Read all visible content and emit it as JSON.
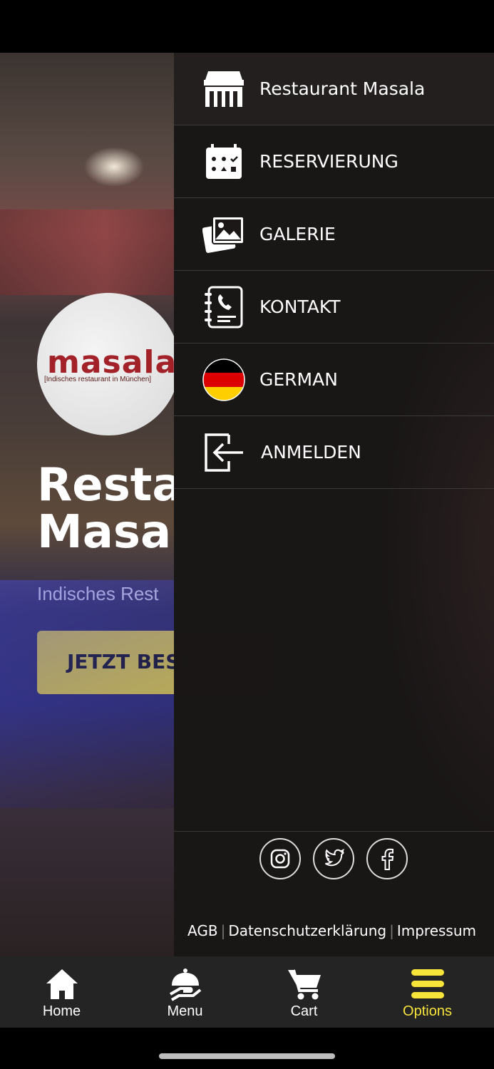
{
  "hero": {
    "logo_word": "masala",
    "logo_sub": "[Indisches restaurant in München]",
    "title_line1": "Resta",
    "title_line2": "Masa",
    "subtitle": "Indisches Rest",
    "order_button": "JETZT BEST"
  },
  "drawer": {
    "items": [
      {
        "label": "Restaurant Masala",
        "icon": "store-icon"
      },
      {
        "label": "RESERVIERUNG",
        "icon": "calendar-icon"
      },
      {
        "label": "GALERIE",
        "icon": "gallery-icon"
      },
      {
        "label": "KONTAKT",
        "icon": "contact-icon"
      },
      {
        "label": "GERMAN",
        "icon": "germany-flag-icon"
      },
      {
        "label": "ANMELDEN",
        "icon": "login-icon"
      }
    ],
    "social": [
      "instagram-icon",
      "twitter-icon",
      "facebook-icon"
    ],
    "footer": {
      "agb": "AGB",
      "privacy": "Datenschutzerklärung",
      "imprint": "Impressum",
      "separator": "|"
    }
  },
  "bottom_nav": {
    "items": [
      {
        "label": "Home",
        "icon": "home-icon"
      },
      {
        "label": "Menu",
        "icon": "cloche-icon"
      },
      {
        "label": "Cart",
        "icon": "cart-icon"
      },
      {
        "label": "Options",
        "icon": "hamburger-icon"
      }
    ],
    "active_color": "#f7e43b"
  },
  "colors": {
    "accent": "#f7e43b",
    "drawer_bg": "#1c1818",
    "nav_bg": "#242424"
  }
}
